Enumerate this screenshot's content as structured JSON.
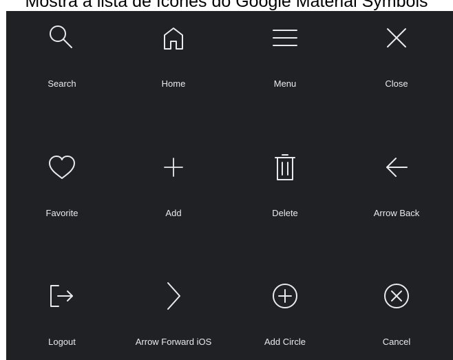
{
  "caption": "Mostra a lista de ícones do Google Material Symbols",
  "icons": [
    {
      "label": "Search",
      "icon": "search-icon"
    },
    {
      "label": "Home",
      "icon": "home-icon"
    },
    {
      "label": "Menu",
      "icon": "menu-icon"
    },
    {
      "label": "Close",
      "icon": "close-icon"
    },
    {
      "label": "Favorite",
      "icon": "favorite-icon"
    },
    {
      "label": "Add",
      "icon": "add-icon"
    },
    {
      "label": "Delete",
      "icon": "delete-icon"
    },
    {
      "label": "Arrow Back",
      "icon": "arrow-back-icon"
    },
    {
      "label": "Logout",
      "icon": "logout-icon"
    },
    {
      "label": "Arrow Forward iOS",
      "icon": "arrow-forward-ios-icon"
    },
    {
      "label": "Add Circle",
      "icon": "add-circle-icon"
    },
    {
      "label": "Cancel",
      "icon": "cancel-icon"
    }
  ],
  "colors": {
    "panel_background": "#202124",
    "icon": "#e8eaed",
    "label": "#e8eaed"
  }
}
